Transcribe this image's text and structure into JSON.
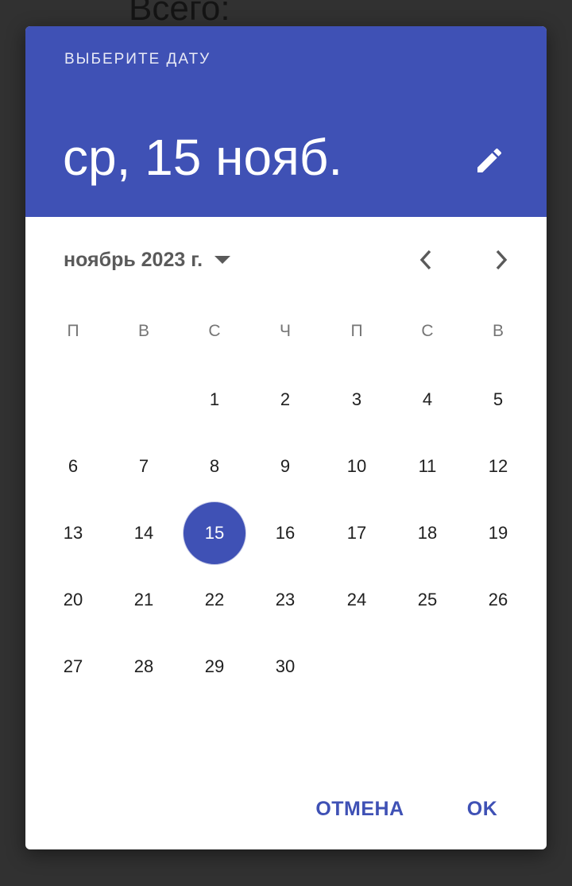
{
  "background": {
    "text": "Всего:"
  },
  "header": {
    "label": "ВЫБЕРИТЕ ДАТУ",
    "selected_date": "ср, 15 нояб.",
    "edit_icon": "pencil-icon"
  },
  "calendar": {
    "month_label": "ноябрь 2023 г.",
    "dropdown_icon": "arrow-drop-down-icon",
    "prev_icon": "chevron-left-icon",
    "next_icon": "chevron-right-icon",
    "weekdays": [
      "П",
      "В",
      "С",
      "Ч",
      "П",
      "С",
      "В"
    ],
    "days": [
      "1",
      "2",
      "3",
      "4",
      "5",
      "6",
      "7",
      "8",
      "9",
      "10",
      "11",
      "12",
      "13",
      "14",
      "15",
      "16",
      "17",
      "18",
      "19",
      "20",
      "21",
      "22",
      "23",
      "24",
      "25",
      "26",
      "27",
      "28",
      "29",
      "30"
    ],
    "first_weekday_index": 2,
    "selected_day": 15
  },
  "actions": {
    "cancel": "ОТМЕНА",
    "ok": "OK"
  },
  "colors": {
    "accent": "#3F51B5",
    "scrim": "#313131",
    "surface": "#FFFFFF"
  }
}
